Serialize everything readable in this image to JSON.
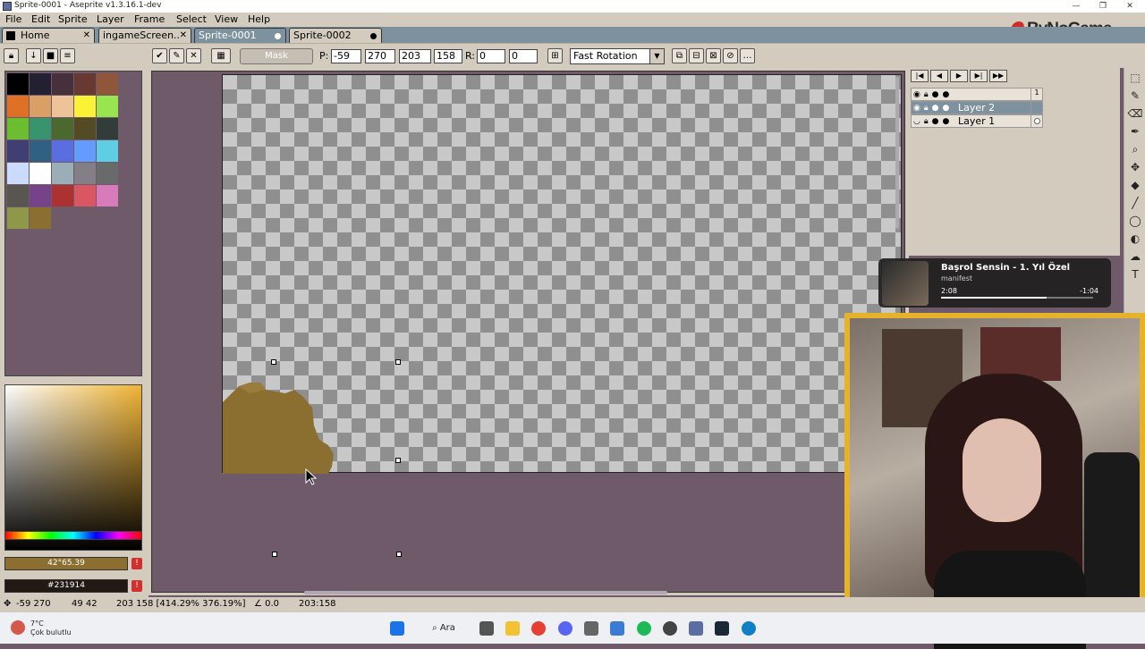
{
  "window": {
    "title": "Sprite-0001 - Aseprite v1.3.16.1-dev",
    "minimize": "—",
    "maximize": "❐",
    "close": "✕"
  },
  "menu": [
    "File",
    "Edit",
    "Sprite",
    "Layer",
    "Frame",
    "Select",
    "View",
    "Help"
  ],
  "tabs": [
    {
      "label": "Home"
    },
    {
      "label": "ingameScreen.."
    },
    {
      "label": "Sprite-0001"
    },
    {
      "label": "Sprite-0002"
    }
  ],
  "toolbar": {
    "mask_label": "Mask",
    "p_label": "P:",
    "x": "-59",
    "y": "270",
    "w": "203",
    "h": "158",
    "r_label": "R:",
    "r1": "0",
    "r2": "0",
    "rotation": "Fast Rotation"
  },
  "palette": {
    "colors": [
      "#000000",
      "#232033",
      "#46303c",
      "#663931",
      "#8f563b",
      "#df7126",
      "#d9a066",
      "#eec39a",
      "#fbf236",
      "#99e550",
      "#6abe30",
      "#37946e",
      "#4b692f",
      "#524b24",
      "#323c39",
      "#3f3f74",
      "#306082",
      "#5b6ee1",
      "#639bff",
      "#5fcde4",
      "#cbdbfc",
      "#ffffff",
      "#9badb7",
      "#847e87",
      "#696a6a",
      "#595652",
      "#76428a",
      "#ac3232",
      "#d95763",
      "#d77bba",
      "#8f974a",
      "#8a6f30"
    ]
  },
  "color_hsv": "42°65.39",
  "color_hex": "#231914",
  "status": {
    "pos": "-59 270",
    "size": "49 42",
    "rect": "203 158 [414.29% 376.19%]",
    "angle": "∠ 0.0",
    "dims": "203:158"
  },
  "layers": [
    {
      "name": "",
      "selected": false
    },
    {
      "name": "Layer 2",
      "selected": true
    },
    {
      "name": "Layer 1",
      "selected": false
    }
  ],
  "frame_number": "1",
  "music": {
    "song": "Başrol Sensin - 1. Yıl Özel",
    "artist": "manifest",
    "elapsed": "2:08",
    "remaining": "-1:04",
    "progress": 0.67
  },
  "weather": {
    "temp": "7°C",
    "desc": "Çok bulutlu"
  },
  "taskbar_search": "Ara",
  "logo": "ByNoGame",
  "colors": {
    "accent": "#7d929e",
    "panel": "#d3cbbe",
    "bg": "#6e5a68",
    "sprite": "#8a6f30",
    "webcam_frame": "#e4b22b"
  }
}
